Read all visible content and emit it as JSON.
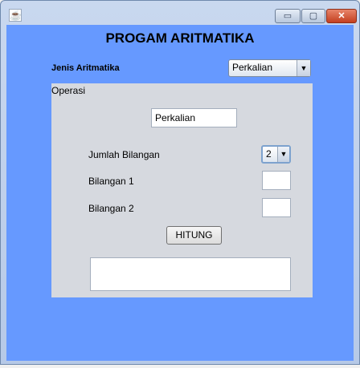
{
  "window": {
    "icon": "java-coffee-icon",
    "minimize_glyph": "▭",
    "maximize_glyph": "▢",
    "close_glyph": "✕"
  },
  "form": {
    "title": "PROGAM ARITMATIKA",
    "jenis_label": "Jenis Aritmatika",
    "jenis_value": "Perkalian"
  },
  "panel": {
    "label": "Operasi",
    "operation_value": "Perkalian",
    "jumlah_label": "Jumlah Bilangan",
    "jumlah_value": "2",
    "bilangan1_label": "Bilangan 1",
    "bilangan1_value": "",
    "bilangan2_label": "Bilangan 2",
    "bilangan2_value": "",
    "button_label": "HITUNG",
    "result_value": ""
  },
  "colors": {
    "content_bg": "#6699ff",
    "panel_bg": "#d6d9df"
  }
}
